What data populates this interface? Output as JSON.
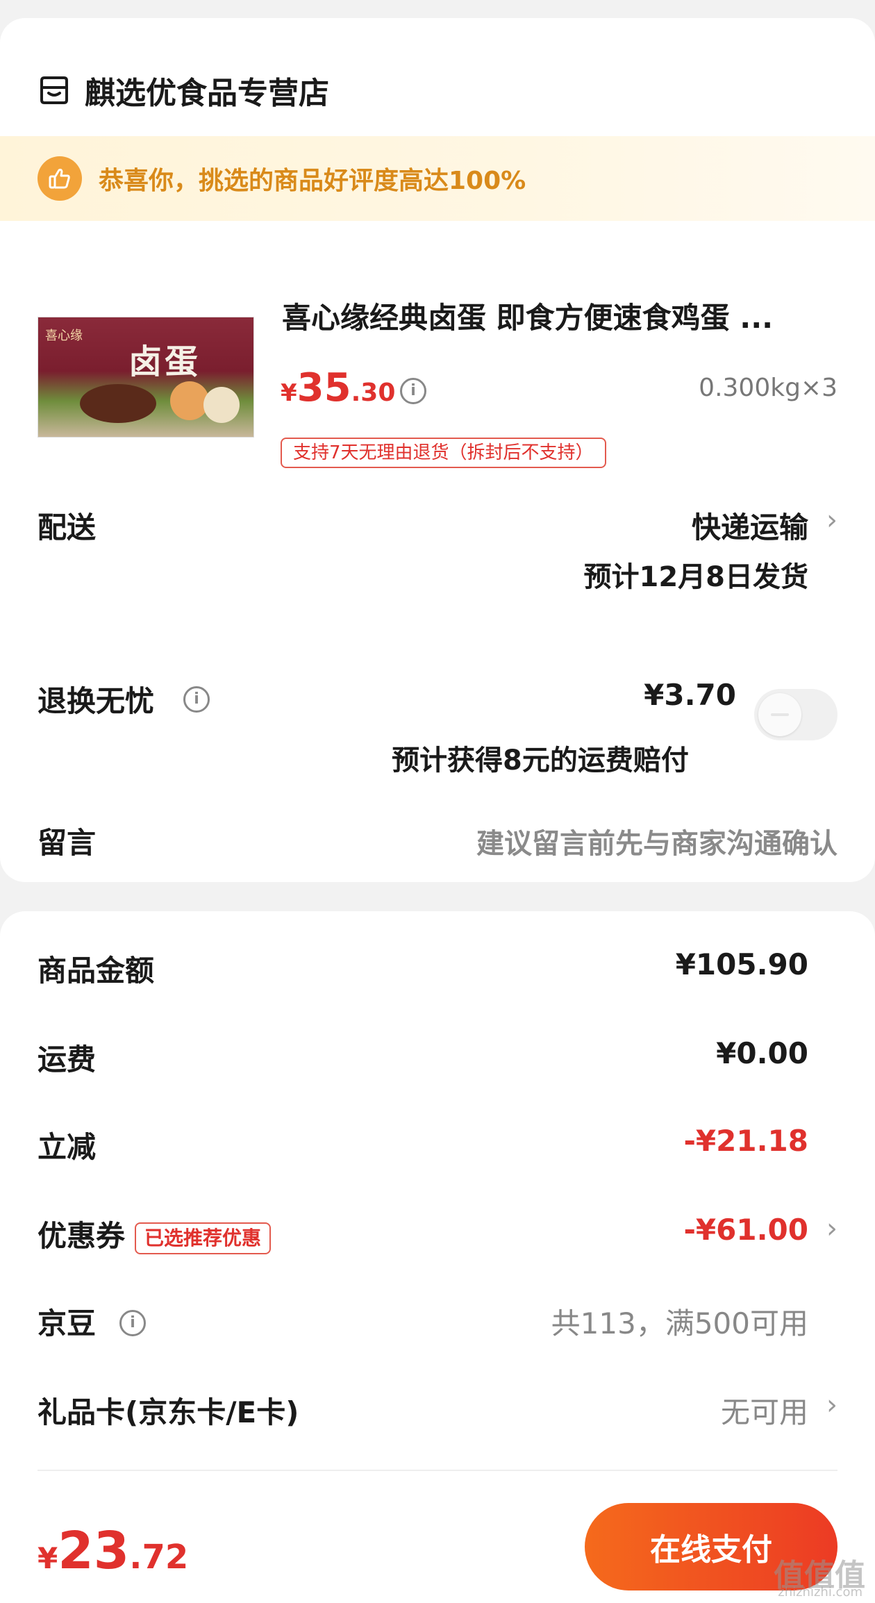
{
  "store": {
    "name": "麒选优食品专营店",
    "icon": "store-icon"
  },
  "praise": {
    "text": "恭喜你，挑选的商品好评度高达100%",
    "icon": "thumbs-up-icon",
    "color": "#d98a1a"
  },
  "product": {
    "image_label": "卤蛋",
    "image_brand": "喜心缘",
    "title": "喜心缘经典卤蛋 即食方便速食鸡蛋 ...",
    "price_yen": "¥",
    "price_int": "35",
    "price_dec": ".30",
    "spec": "0.300kg×3",
    "return_badge": "支持7天无理由退货（拆封后不支持）"
  },
  "delivery": {
    "label": "配送",
    "method": "快递运输",
    "estimate": "预计12月8日发货"
  },
  "return_worry": {
    "label": "退换无忧",
    "price": "¥3.70",
    "compensation": "预计获得8元的运费赔付",
    "enabled": false
  },
  "message": {
    "label": "留言",
    "placeholder": "建议留言前先与商家沟通确认"
  },
  "summary": {
    "goods_amount": {
      "label": "商品金额",
      "value": "¥105.90"
    },
    "shipping": {
      "label": "运费",
      "value": "¥0.00"
    },
    "discount": {
      "label": "立减",
      "value": "-¥21.18"
    },
    "coupon": {
      "label": "优惠券",
      "tag": "已选推荐优惠",
      "value": "-¥61.00"
    },
    "jd_beans": {
      "label": "京豆",
      "value": "共113，满500可用"
    },
    "gift_card": {
      "label": "礼品卡(京东卡/E卡)",
      "value": "无可用"
    }
  },
  "footer": {
    "total_yen": "¥",
    "total_int": "23",
    "total_dec": ".72",
    "pay_label": "在线支付"
  },
  "watermark": {
    "text": "值值值",
    "url": "zhizhizhi.com"
  },
  "colors": {
    "accent_red": "#e0312d",
    "pay_gradient_start": "#f56a1c",
    "pay_gradient_end": "#ec3b24"
  }
}
